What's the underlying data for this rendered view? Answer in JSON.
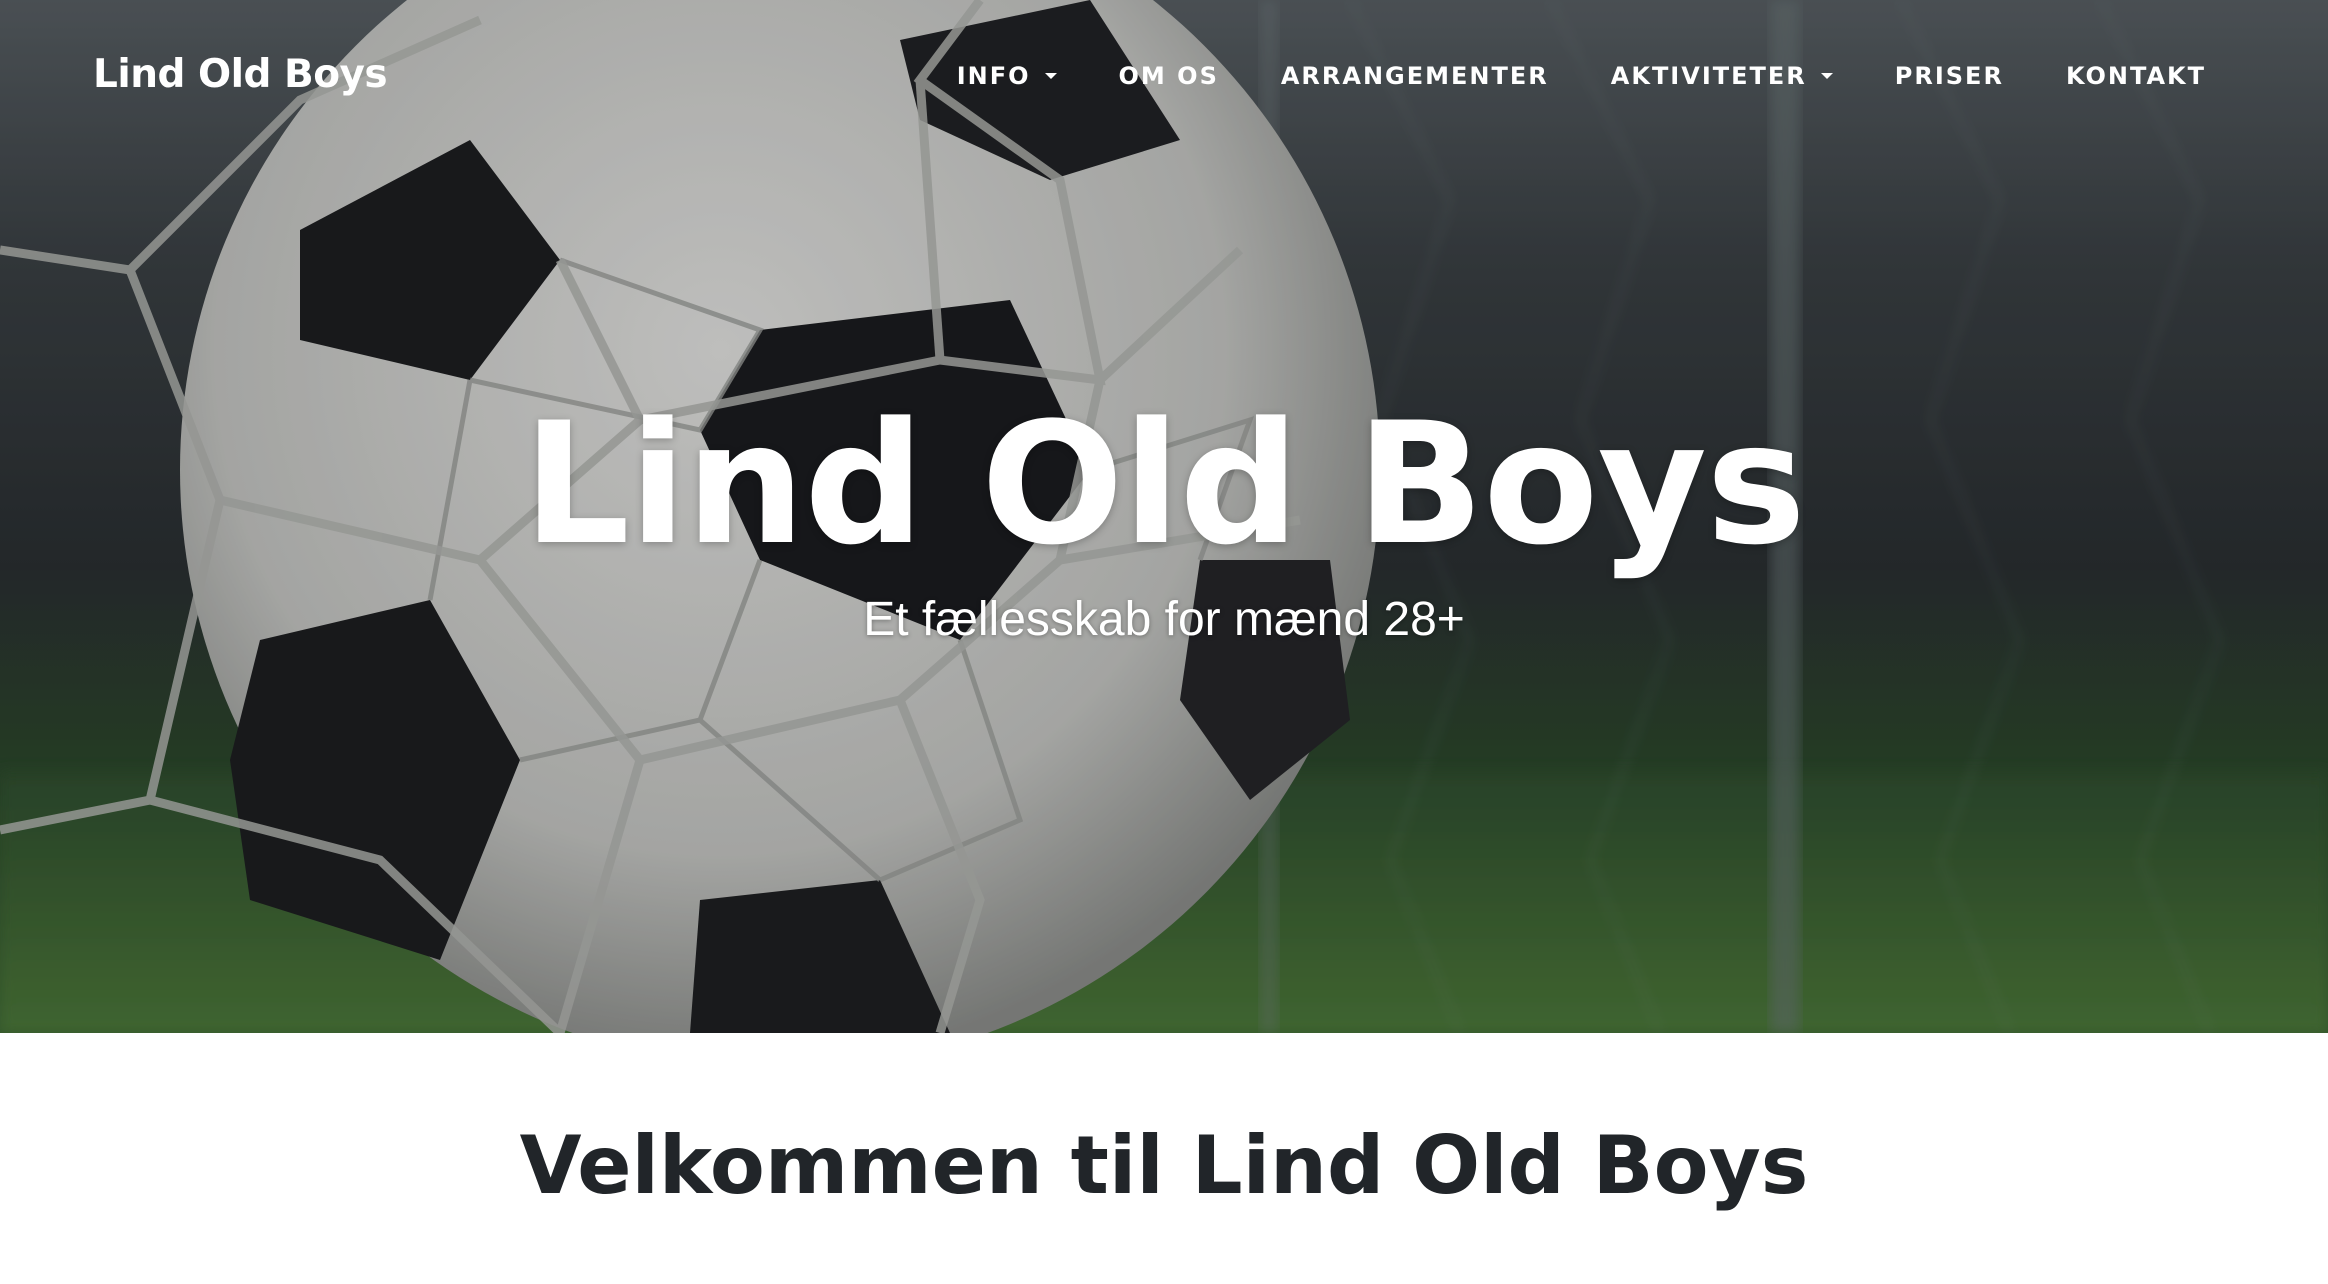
{
  "brand": "Lind Old Boys",
  "nav": [
    {
      "label": "INFO",
      "dropdown": true
    },
    {
      "label": "OM OS",
      "dropdown": false
    },
    {
      "label": "ARRANGEMENTER",
      "dropdown": false
    },
    {
      "label": "AKTIVITETER",
      "dropdown": true
    },
    {
      "label": "PRISER",
      "dropdown": false
    },
    {
      "label": "KONTAKT",
      "dropdown": false
    }
  ],
  "hero": {
    "title": "Lind Old Boys",
    "subtitle": "Et fællesskab for mænd 28+"
  },
  "main": {
    "heading": "Velkommen til Lind Old Boys"
  }
}
